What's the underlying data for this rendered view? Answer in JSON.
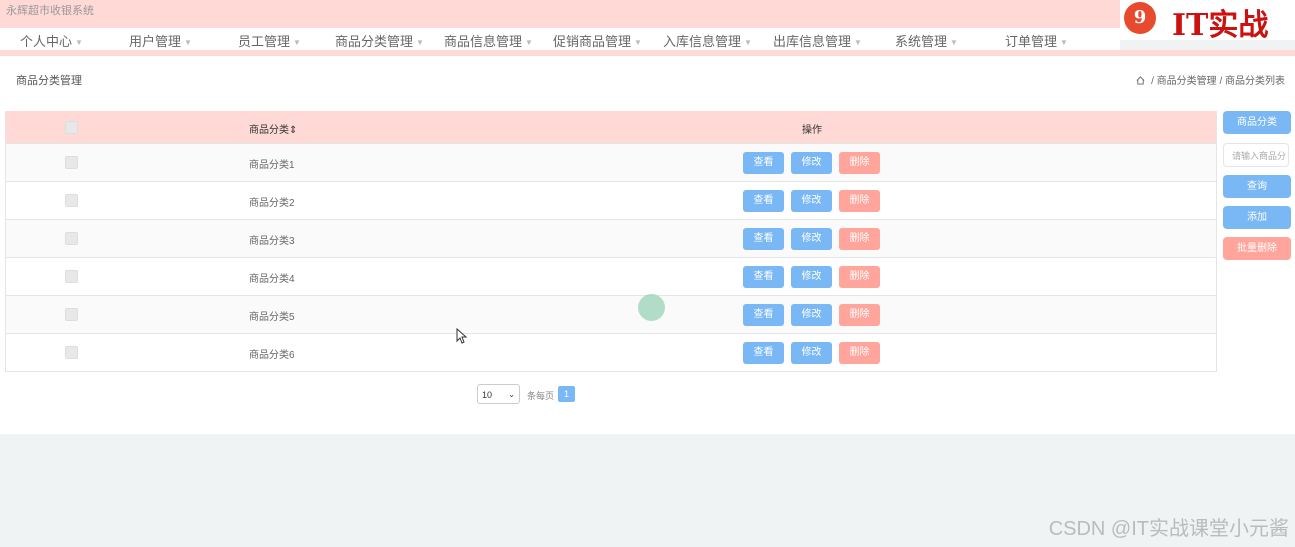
{
  "app": {
    "title": "永辉超市收银系统"
  },
  "logo": {
    "symbol": "9",
    "text": "IT实战"
  },
  "nav": [
    {
      "label": "个人中心"
    },
    {
      "label": "用户管理"
    },
    {
      "label": "员工管理"
    },
    {
      "label": "商品分类管理"
    },
    {
      "label": "商品信息管理"
    },
    {
      "label": "促销商品管理"
    },
    {
      "label": "入库信息管理"
    },
    {
      "label": "出库信息管理"
    },
    {
      "label": "系统管理"
    },
    {
      "label": "订单管理"
    }
  ],
  "page": {
    "title": "商品分类管理",
    "breadcrumb": [
      {
        "label": "商品分类管理"
      },
      {
        "label": "商品分类列表"
      }
    ],
    "separator": "/"
  },
  "table": {
    "headers": {
      "name": "商品分类",
      "sort_glyph": "⇕",
      "actions": "操作"
    },
    "rows": [
      {
        "name": "商品分类1"
      },
      {
        "name": "商品分类2"
      },
      {
        "name": "商品分类3"
      },
      {
        "name": "商品分类4"
      },
      {
        "name": "商品分类5"
      },
      {
        "name": "商品分类6"
      }
    ],
    "actions": {
      "view": "查看",
      "edit": "修改",
      "delete": "删除"
    }
  },
  "sidebar": {
    "category_label": "商品分类",
    "search_placeholder": "请输入商品分",
    "query": "查询",
    "add": "添加",
    "batch_delete": "批量删除"
  },
  "pagination": {
    "page_size": "10",
    "per_page_label": "条每页",
    "current_page": "1"
  },
  "watermark": "CSDN @IT实战课堂小元酱",
  "colors": {
    "header_pink": "#ffd9d5",
    "button_blue": "#7ab8f5",
    "button_red": "#ffa59b",
    "logo_red": "#cc1111"
  }
}
